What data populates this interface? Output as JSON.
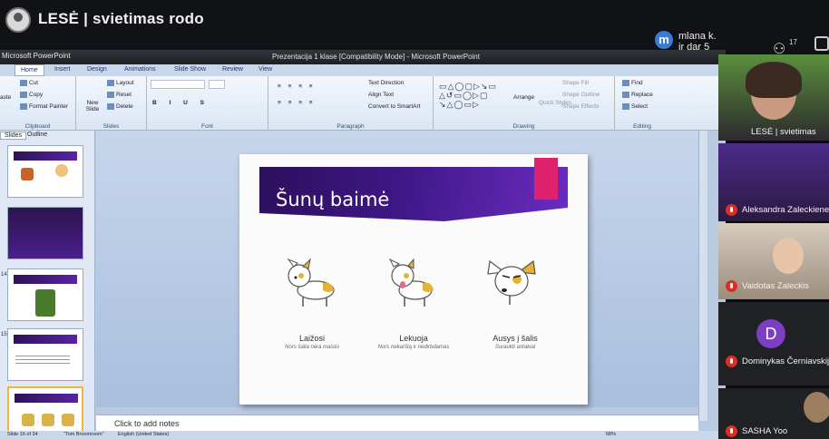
{
  "meeting": {
    "title": "LESĖ | svietimas rodo",
    "presenter_initial": "m",
    "presenter_line1": "mlana k.",
    "presenter_line2": "ir dar 5",
    "people_count": "17"
  },
  "powerpoint": {
    "app_label": "Microsoft PowerPoint",
    "window_title": "Prezentacija 1 klase [Compatibility Mode] - Microsoft PowerPoint",
    "tabs": [
      "Home",
      "Insert",
      "Design",
      "Animations",
      "Slide Show",
      "Review",
      "View"
    ],
    "ribbon": {
      "clipboard": {
        "paste": "aste",
        "cut": "Cut",
        "copy": "Copy",
        "format_painter": "Format Painter",
        "label": "Clipboard"
      },
      "slides": {
        "new_slide": "New Slide",
        "layout": "Layout",
        "reset": "Reset",
        "delete": "Delete",
        "label": "Slides"
      },
      "font": {
        "label": "Font"
      },
      "paragraph": {
        "text_direction": "Text Direction",
        "align_text": "Align Text",
        "smartart": "Convert to SmartArt",
        "label": "Paragraph"
      },
      "drawing": {
        "arrange": "Arrange",
        "quick_styles": "Quick Styles",
        "shape_fill": "Shape Fill",
        "shape_outline": "Shape Outline",
        "shape_effects": "Shape Effects",
        "label": "Drawing"
      },
      "editing": {
        "find": "Find",
        "replace": "Replace",
        "select": "Select",
        "label": "Editing"
      }
    },
    "pane_tabs": {
      "slides": "Slides",
      "outline": "Outline"
    },
    "slide_numbers": [
      "14",
      "15"
    ],
    "slide": {
      "title": "Šunų baimė",
      "items": [
        {
          "main": "Laižosi",
          "sub": "Nors šalia nėra maisto"
        },
        {
          "main": "Lekuoja",
          "sub": "Nors nekarštą ir nedirbdamas"
        },
        {
          "main": "Ausys į šalis",
          "sub": "Suraukti antakiai"
        }
      ]
    },
    "notes_placeholder": "Click to add notes",
    "status": {
      "slide_info": "Slide 16 of 34",
      "theme": "\"Tom Broomroom\"",
      "language": "English (United States)",
      "zoom": "68%"
    }
  },
  "participants": [
    {
      "name": "LESĖ | svietimas"
    },
    {
      "name": "Aleksandra Zaleckiene"
    },
    {
      "name": "Vaidotas Zaleckis"
    },
    {
      "name": "Dominykas Černiavskij",
      "initial": "D"
    },
    {
      "name": "SASHA Yoo"
    }
  ],
  "colors": {
    "meet_bg": "#111216",
    "slide_purple": "#3f1786",
    "slide_accent": "#e0226e",
    "mic_off": "#d93025",
    "avatar_purple": "#7b3fc4"
  }
}
